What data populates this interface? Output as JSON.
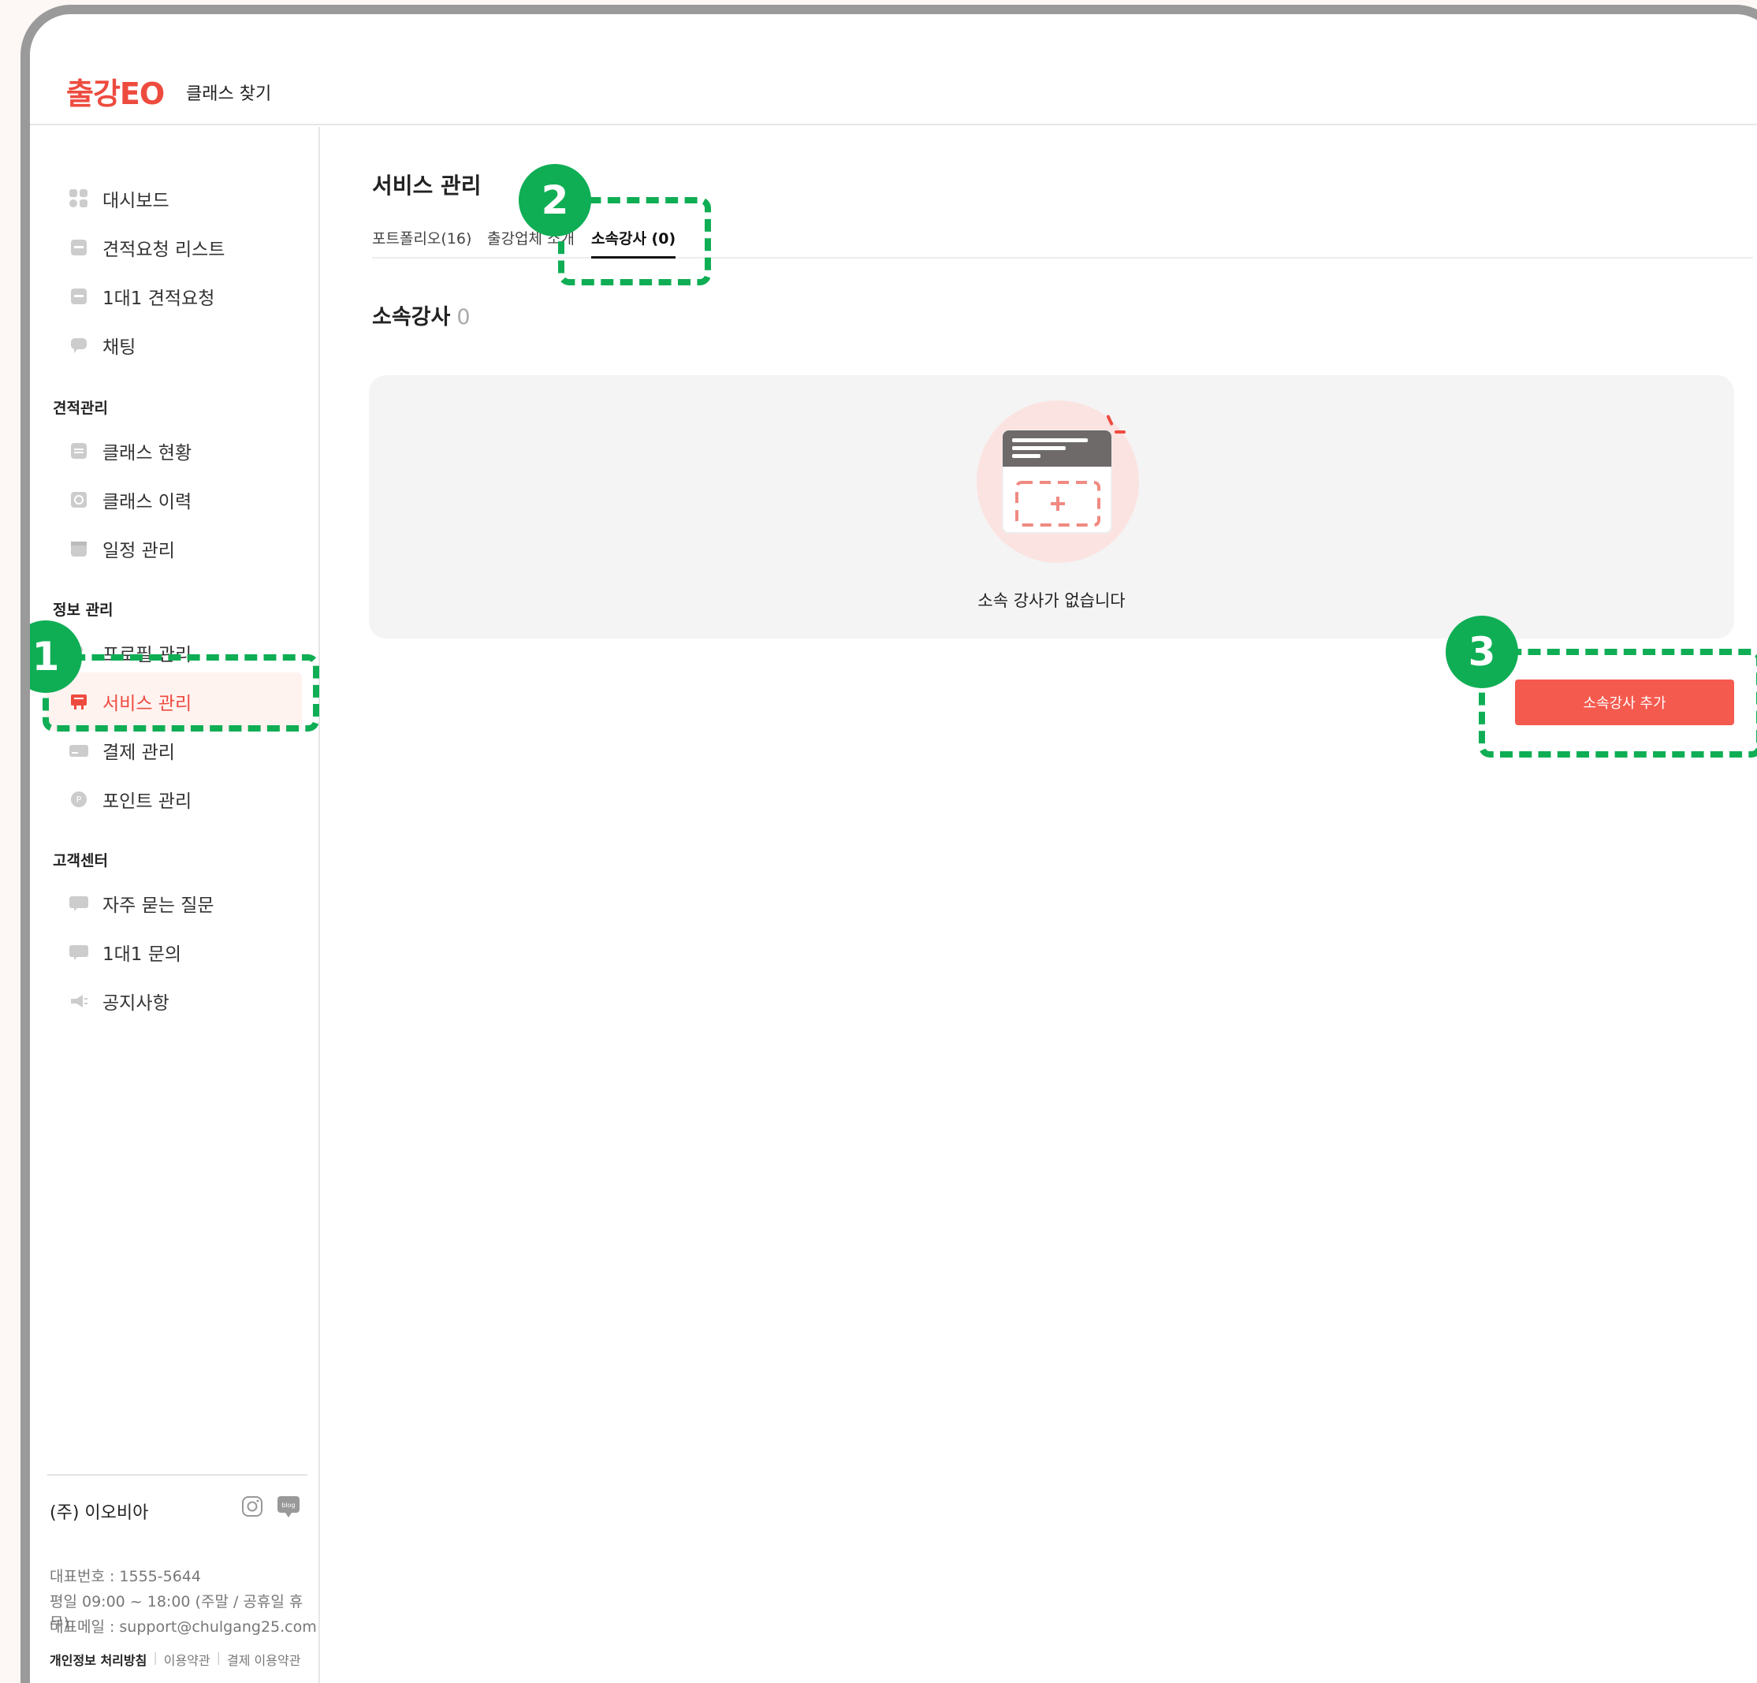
{
  "header": {
    "logo": "출강EO",
    "nav_find": "클래스 찾기"
  },
  "sidebar": {
    "items_top": [
      {
        "label": "대시보드",
        "icon": "dashboard-icon"
      },
      {
        "label": "견적요청 리스트",
        "icon": "list-icon"
      },
      {
        "label": "1대1 견적요청",
        "icon": "one-to-one-icon"
      },
      {
        "label": "채팅",
        "icon": "chat-icon"
      }
    ],
    "section_estimate": "견적관리",
    "items_estimate": [
      {
        "label": "클래스 현황",
        "icon": "status-icon"
      },
      {
        "label": "클래스 이력",
        "icon": "history-icon"
      },
      {
        "label": "일정 관리",
        "icon": "calendar-icon"
      }
    ],
    "section_info": "정보 관리",
    "items_info": [
      {
        "label": "프로필 관리",
        "icon": "profile-icon"
      },
      {
        "label": "서비스 관리",
        "icon": "service-icon"
      },
      {
        "label": "결제 관리",
        "icon": "payment-icon"
      },
      {
        "label": "포인트 관리",
        "icon": "point-icon"
      }
    ],
    "section_support": "고객센터",
    "items_support": [
      {
        "label": "자주 묻는 질문",
        "icon": "faq-icon"
      },
      {
        "label": "1대1 문의",
        "icon": "inquiry-icon"
      },
      {
        "label": "공지사항",
        "icon": "megaphone-icon"
      }
    ]
  },
  "footer": {
    "company": "(주) 이오비아",
    "phone": "대표번호 : 1555-5644",
    "hours": "평일 09:00 ~ 18:00 (주말 / 공휴일 휴무)",
    "email": "대표메일 : support@chulgang25.com",
    "privacy": "개인정보 처리방침",
    "terms": "이용약관",
    "payment_terms": "결제 이용약관",
    "blog_label": "blog"
  },
  "main": {
    "title": "서비스 관리",
    "tabs": [
      "포트폴리오(16)",
      "출강업체 소개",
      "소속강사 (0)"
    ],
    "section_title": "소속강사",
    "section_count": "0",
    "empty_text": "소속 강사가 없습니다",
    "add_button": "소속강사 추가"
  },
  "callouts": [
    "1",
    "2",
    "3"
  ],
  "colors": {
    "brand": "#ee4b3f",
    "button": "#f55a4e",
    "callout": "#0fae55",
    "active_bg": "#fff3f0"
  }
}
